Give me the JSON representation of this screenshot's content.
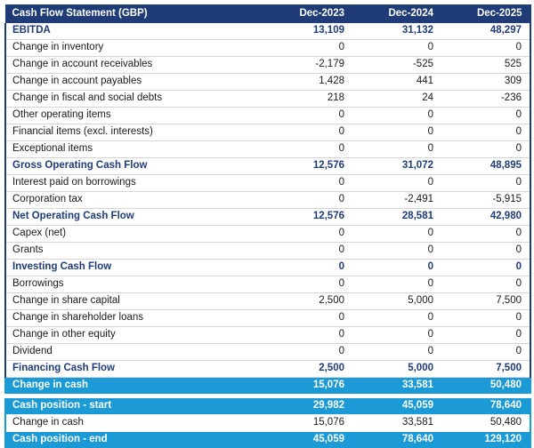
{
  "table": {
    "title": "Cash Flow Statement (GBP)",
    "columns": [
      "Dec-2023",
      "Dec-2024",
      "Dec-2025"
    ],
    "colors": {
      "header_bg": "#1F3C76",
      "header_text": "#FFFFFF",
      "subtotal_text": "#1F3C76",
      "highlight_bg": "#1B9AD6",
      "highlight_text": "#FFFFFF",
      "body_text": "#1A1A1A",
      "row_divider": "#D6D6D6"
    },
    "rows": [
      {
        "label": "EBITDA",
        "style": "subtotal-first",
        "values": [
          "13,109",
          "31,132",
          "48,297"
        ]
      },
      {
        "label": "Change in inventory",
        "style": "normal",
        "values": [
          "0",
          "0",
          "0"
        ]
      },
      {
        "label": "Change in account receivables",
        "style": "normal",
        "values": [
          "-2,179",
          "-525",
          "525"
        ]
      },
      {
        "label": "Change in account payables",
        "style": "normal",
        "values": [
          "1,428",
          "441",
          "309"
        ]
      },
      {
        "label": "Change in fiscal and social debts",
        "style": "normal",
        "values": [
          "218",
          "24",
          "-236"
        ]
      },
      {
        "label": "Other operating items",
        "style": "normal",
        "values": [
          "0",
          "0",
          "0"
        ]
      },
      {
        "label": "Financial items (excl. interests)",
        "style": "normal",
        "values": [
          "0",
          "0",
          "0"
        ]
      },
      {
        "label": "Exceptional items",
        "style": "normal",
        "values": [
          "0",
          "0",
          "0"
        ]
      },
      {
        "label": "Gross Operating Cash Flow",
        "style": "subtotal",
        "values": [
          "12,576",
          "31,072",
          "48,895"
        ]
      },
      {
        "label": "Interest paid on borrowings",
        "style": "normal",
        "values": [
          "0",
          "0",
          "0"
        ]
      },
      {
        "label": "Corporation tax",
        "style": "normal",
        "values": [
          "0",
          "-2,491",
          "-5,915"
        ]
      },
      {
        "label": "Net Operating Cash Flow",
        "style": "subtotal",
        "values": [
          "12,576",
          "28,581",
          "42,980"
        ]
      },
      {
        "label": "Capex (net)",
        "style": "normal",
        "values": [
          "0",
          "0",
          "0"
        ]
      },
      {
        "label": "Grants",
        "style": "normal",
        "values": [
          "0",
          "0",
          "0"
        ]
      },
      {
        "label": "Investing Cash Flow",
        "style": "subtotal",
        "values": [
          "0",
          "0",
          "0"
        ]
      },
      {
        "label": "Borrowings",
        "style": "normal",
        "values": [
          "0",
          "0",
          "0"
        ]
      },
      {
        "label": "Change in share capital",
        "style": "normal",
        "values": [
          "2,500",
          "5,000",
          "7,500"
        ]
      },
      {
        "label": "Change in shareholder loans",
        "style": "normal",
        "values": [
          "0",
          "0",
          "0"
        ]
      },
      {
        "label": "Change in other equity",
        "style": "normal",
        "values": [
          "0",
          "0",
          "0"
        ]
      },
      {
        "label": "Dividend",
        "style": "normal",
        "values": [
          "0",
          "0",
          "0"
        ]
      },
      {
        "label": "Financing Cash Flow",
        "style": "subtotal",
        "values": [
          "2,500",
          "5,000",
          "7,500"
        ]
      },
      {
        "label": "Change in cash",
        "style": "highlight",
        "values": [
          "15,076",
          "33,581",
          "50,480"
        ]
      }
    ],
    "summary_rows": [
      {
        "label": "Cash position - start",
        "style": "highlight",
        "values": [
          "29,982",
          "45,059",
          "78,640"
        ]
      },
      {
        "label": "Change in cash",
        "style": "inblock",
        "values": [
          "15,076",
          "33,581",
          "50,480"
        ]
      },
      {
        "label": "Cash position - end",
        "style": "highlight",
        "values": [
          "45,059",
          "78,640",
          "129,120"
        ]
      }
    ]
  }
}
